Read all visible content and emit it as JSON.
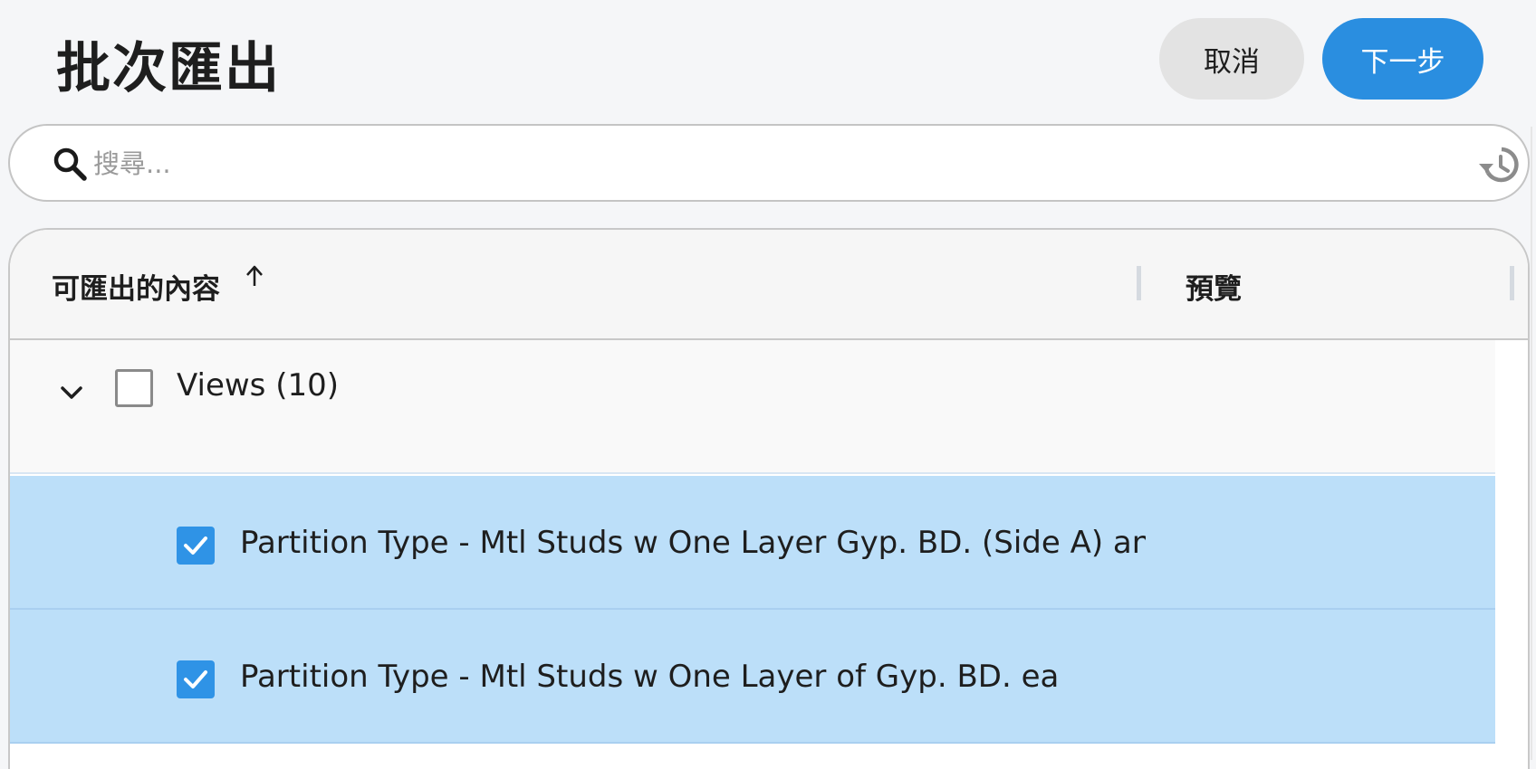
{
  "header": {
    "title": "批次匯出",
    "cancel_label": "取消",
    "next_label": "下一步"
  },
  "search": {
    "placeholder": "搜尋...",
    "value": ""
  },
  "table": {
    "columns": {
      "content": "可匯出的內容",
      "preview": "預覽"
    },
    "sort_direction": "ascending",
    "group": {
      "label": "Views (10)",
      "checked": false,
      "expanded": true
    },
    "items": [
      {
        "label": "Partition Type - Mtl Studs w One Layer Gyp. BD. (Side A) and Two",
        "checked": true
      },
      {
        "label": "Partition Type - Mtl Studs w One Layer of Gyp. BD. ea",
        "checked": true
      }
    ]
  },
  "colors": {
    "accent": "#2a8ee0",
    "selected_row": "#bcdff9",
    "checkbox_checked": "#2f93e6"
  },
  "icons": {
    "search": "search-icon",
    "history": "history-icon",
    "sort": "arrow-up-icon",
    "expand": "chevron-down-icon",
    "check": "checkmark-icon"
  }
}
